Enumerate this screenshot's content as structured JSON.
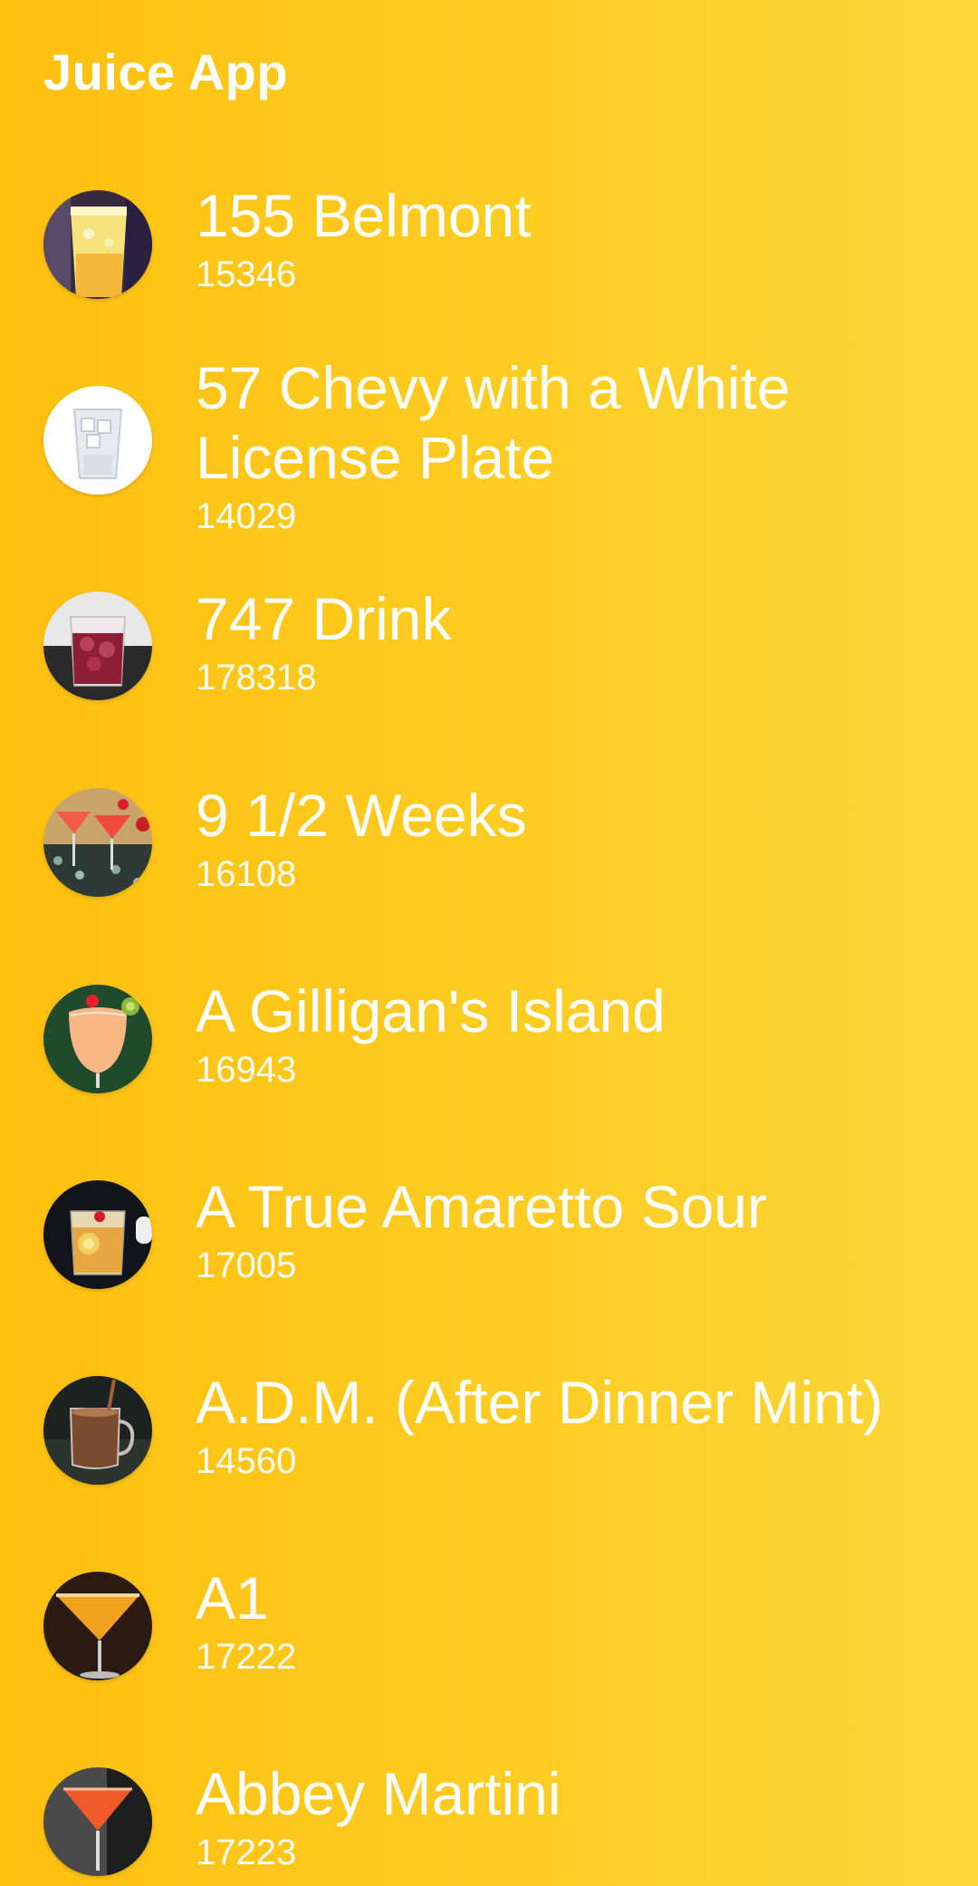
{
  "app": {
    "title": "Juice App"
  },
  "drinks": [
    {
      "name": "155 Belmont",
      "id": "15346",
      "thumb": "yellow-highball-thumbnail"
    },
    {
      "name": "57 Chevy with a White License Plate",
      "id": "14029",
      "thumb": "ice-glass-thumbnail"
    },
    {
      "name": "747 Drink",
      "id": "178318",
      "thumb": "red-rocks-drink-thumbnail"
    },
    {
      "name": "9 1/2 Weeks",
      "id": "16108",
      "thumb": "pink-martini-thumbnail"
    },
    {
      "name": "A Gilligan's Island",
      "id": "16943",
      "thumb": "peach-tropical-thumbnail"
    },
    {
      "name": "A True Amaretto Sour",
      "id": "17005",
      "thumb": "amber-rocks-thumbnail"
    },
    {
      "name": "A.D.M. (After Dinner Mint)",
      "id": "14560",
      "thumb": "chocolate-mug-thumbnail"
    },
    {
      "name": "A1",
      "id": "17222",
      "thumb": "orange-martini-thumbnail"
    },
    {
      "name": "Abbey Martini",
      "id": "17223",
      "thumb": "red-martini-thumbnail"
    }
  ],
  "colors": {
    "background_start": "#FFC010",
    "background_end": "#FCD63A",
    "text": "#FFFFFF"
  }
}
